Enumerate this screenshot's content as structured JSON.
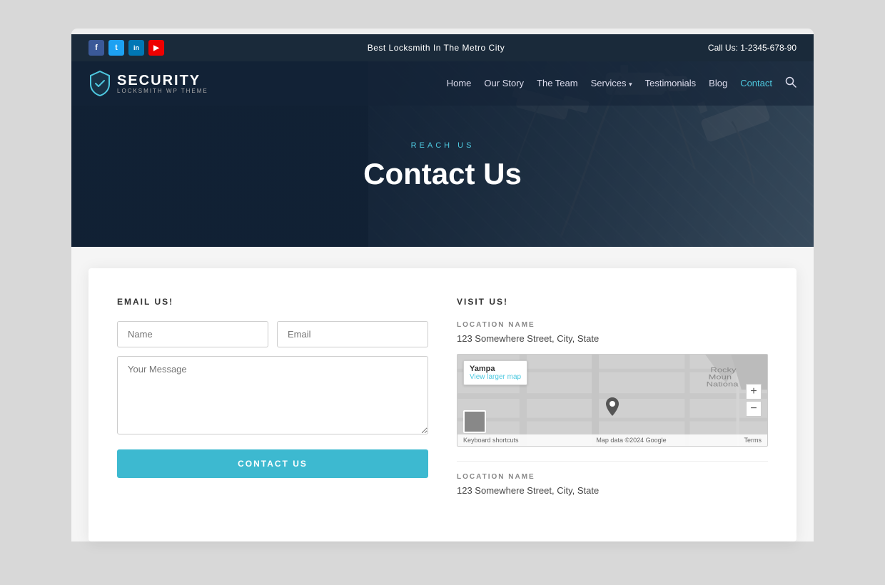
{
  "page": {
    "bg_color": "#d8d8d8"
  },
  "topbar": {
    "tagline": "Best Locksmith In The Metro City",
    "phone_label": "Call Us: 1-2345-678-90",
    "social": [
      {
        "id": "fb",
        "label": "f",
        "name": "facebook"
      },
      {
        "id": "tw",
        "label": "t",
        "name": "twitter"
      },
      {
        "id": "li",
        "label": "in",
        "name": "linkedin"
      },
      {
        "id": "yt",
        "label": "▶",
        "name": "youtube"
      }
    ]
  },
  "nav": {
    "logo_text": "SECURITY",
    "logo_sub": "LOCKSMITH WP THEME",
    "links": [
      {
        "label": "Home",
        "active": false
      },
      {
        "label": "Our Story",
        "active": false
      },
      {
        "label": "The Team",
        "active": false
      },
      {
        "label": "Services",
        "active": false,
        "has_dropdown": true
      },
      {
        "label": "Testimonials",
        "active": false
      },
      {
        "label": "Blog",
        "active": false
      },
      {
        "label": "Contact",
        "active": true
      }
    ]
  },
  "hero": {
    "subtitle": "REACH US",
    "title": "Contact Us"
  },
  "form_section": {
    "heading": "EMAIL US!",
    "name_placeholder": "Name",
    "email_placeholder": "Email",
    "message_placeholder": "Your Message",
    "submit_label": "CONTACT US"
  },
  "visit_section": {
    "heading": "VISIT US!",
    "location1": {
      "label": "LOCATION NAME",
      "address": "123 Somewhere Street, City, State",
      "map_town": "Yampa",
      "map_link": "View larger map",
      "zoom_in": "+",
      "zoom_out": "−",
      "keyboard_shortcuts": "Keyboard shortcuts",
      "map_data": "Map data ©2024 Google",
      "terms": "Terms"
    },
    "location2": {
      "label": "LOCATION NAME",
      "address": "123 Somewhere Street, City, State"
    }
  }
}
